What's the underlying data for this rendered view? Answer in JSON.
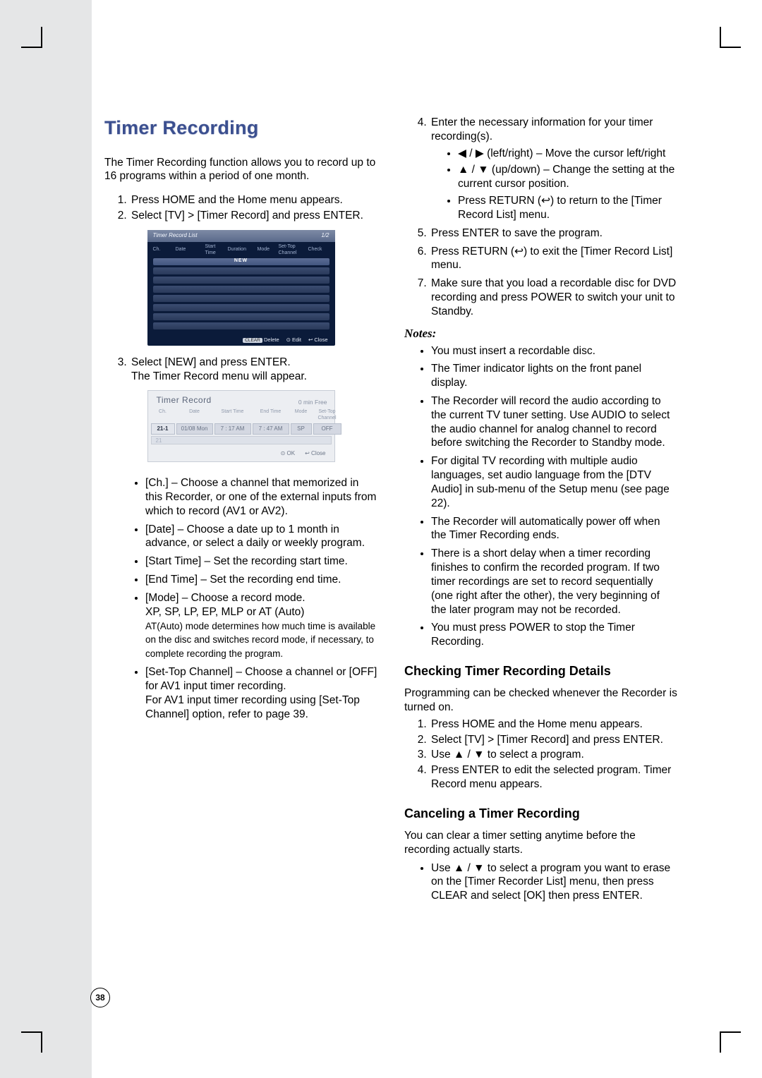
{
  "page_number": "38",
  "left": {
    "title": "Timer Recording",
    "intro": "The Timer Recording function allows you to record up to 16 programs within a period of one month.",
    "steps": [
      "Press HOME and the Home menu appears.",
      "Select [TV] > [Timer Record] and press ENTER."
    ],
    "shot1": {
      "title": "Timer Record List",
      "page": "1/2",
      "cols": [
        "Ch.",
        "Date",
        "Start Time",
        "Duration",
        "Mode",
        "Set-Top Channel",
        "Check"
      ],
      "new": "NEW",
      "footer_clear": "CLEAR",
      "footer_delete": "Delete",
      "footer_edit": "Edit",
      "footer_close": "Close"
    },
    "step3a": "Select [NEW] and press ENTER.",
    "step3b": "The Timer Record menu will appear.",
    "shot2": {
      "title": "Timer Record",
      "free": "0   min Free",
      "cols": [
        "Ch.",
        "Date",
        "Start Time",
        "End Time",
        "Mode",
        "Set-Top Channel"
      ],
      "row": [
        "21-1",
        "01/08 Mon",
        "7 : 17 AM",
        "7 : 47 AM",
        "SP",
        "OFF"
      ],
      "empty": "21",
      "ok": "OK",
      "close": "Close"
    },
    "fields": [
      {
        "t": "[Ch.] – Choose a channel that memorized in this Recorder, or one of the external inputs from which to record (AV1 or AV2)."
      },
      {
        "t": "[Date] – Choose a date up to 1 month in advance, or select a daily or weekly program."
      },
      {
        "t": "[Start Time] – Set the recording start time."
      },
      {
        "t": "[End Time] – Set the recording end time."
      },
      {
        "t": "[Mode] – Choose a record mode.",
        "sub1": "XP, SP, LP, EP, MLP or AT (Auto)",
        "sub2": "AT(Auto) mode determines how much time is available on the disc and switches record mode, if necessary, to complete recording the program."
      },
      {
        "t": "[Set-Top Channel] – Choose a channel or [OFF] for AV1 input timer recording.",
        "sub1": "For AV1 input timer recording using [Set-Top Channel] option, refer to page 39."
      }
    ]
  },
  "right": {
    "step4": "Enter the necessary information for your timer recording(s).",
    "step4_bullets": [
      "◀ / ▶ (left/right) – Move the cursor left/right",
      "▲ / ▼ (up/down) – Change the setting at the current cursor position.",
      "Press RETURN (↩) to return to the [Timer Record List] menu."
    ],
    "step5": "Press ENTER to save the program.",
    "step6": "Press RETURN (↩) to exit the [Timer Record List] menu.",
    "step7": "Make sure that you load a recordable disc for DVD recording and press POWER to switch your unit to Standby.",
    "notes_head": "Notes:",
    "notes": [
      "You must insert a recordable disc.",
      "The Timer indicator lights on the front panel display.",
      "The Recorder will record the audio according to the current TV tuner setting. Use AUDIO to select the audio channel for analog channel to record before switching the Recorder to Standby mode.",
      "For digital TV recording with multiple audio languages, set audio language from the [DTV Audio] in sub-menu of the Setup menu (see page 22).",
      "The Recorder will automatically power off when the Timer Recording ends.",
      "There is a short delay when a timer recording finishes to confirm the recorded program. If two timer recordings are set to record sequentially (one right after the other), the very beginning of the later program may not be recorded.",
      "You must press POWER to stop the Timer Recording."
    ],
    "check_head": "Checking Timer Recording Details",
    "check_intro": "Programming can be checked whenever the Recorder is turned on.",
    "check_list": [
      "Press HOME and the Home menu appears.",
      "Select [TV] > [Timer Record] and press ENTER.",
      "Use ▲ / ▼ to select a program.",
      "Press ENTER to edit the selected program. Timer Record menu appears."
    ],
    "cancel_head": "Canceling a Timer Recording",
    "cancel_intro": "You can clear a timer setting anytime before the recording actually starts.",
    "cancel_bullet": "Use ▲ / ▼ to select a program you want to erase on the [Timer Recorder List] menu, then press CLEAR and select [OK] then press ENTER."
  }
}
